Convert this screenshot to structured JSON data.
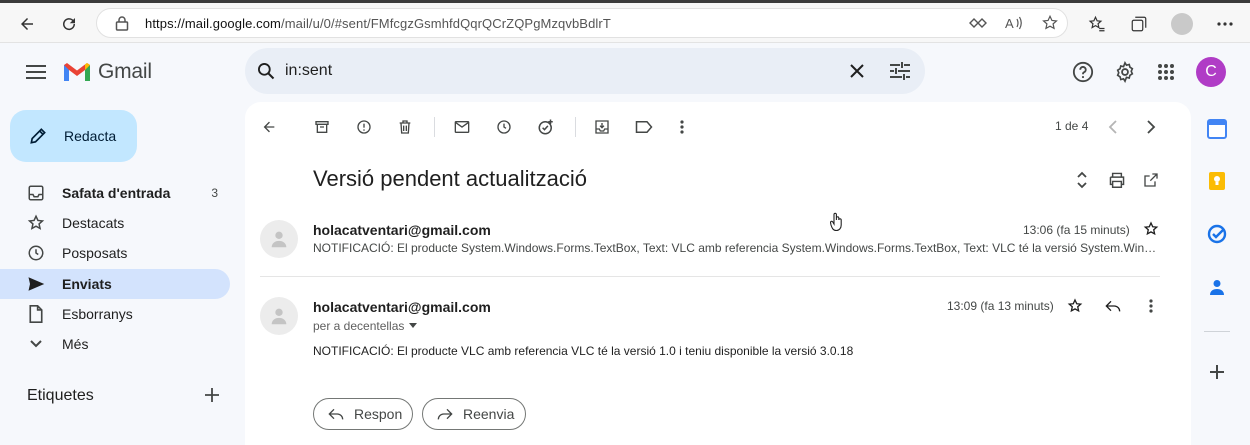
{
  "browser": {
    "url_host": "https://mail.google.com",
    "url_rest": "/mail/u/0/#sent/FMfcgzGsmhfdQqrQCrZQPgMzqvbBdlrT"
  },
  "app": {
    "name": "Gmail"
  },
  "search": {
    "value": "in:sent"
  },
  "user": {
    "avatar_letter": "C"
  },
  "compose": {
    "label": "Redacta"
  },
  "nav": {
    "items": [
      {
        "label": "Safata d'entrada",
        "count": "3"
      },
      {
        "label": "Destacats"
      },
      {
        "label": "Posposats"
      },
      {
        "label": "Enviats"
      },
      {
        "label": "Esborranys"
      },
      {
        "label": "Més"
      }
    ],
    "labels_title": "Etiquetes"
  },
  "thread": {
    "pager": "1 de 4",
    "subject": "Versió pendent actualització",
    "messages": [
      {
        "sender": "holacatventari@gmail.com",
        "time": "13:06 (fa 15 minuts)",
        "snippet": "NOTIFICACIÓ: El producte System.Windows.Forms.TextBox, Text: VLC amb referencia System.Windows.Forms.TextBox, Text: VLC té la versió System.Windows.Forms.TextBox"
      },
      {
        "sender": "holacatventari@gmail.com",
        "time": "13:09 (fa 13 minuts)",
        "to": "per a decentellas",
        "body": "NOTIFICACIÓ: El producte VLC amb referencia VLC té la versió 1.0 i teniu disponible la versió 3.0.18"
      }
    ],
    "reply_label": "Respon",
    "forward_label": "Reenvia"
  },
  "colors": {
    "compose_bg": "#c2e7ff",
    "active_nav": "#d3e3fd",
    "search_bg": "#e9eef6",
    "avatar": "#b03cc6"
  }
}
